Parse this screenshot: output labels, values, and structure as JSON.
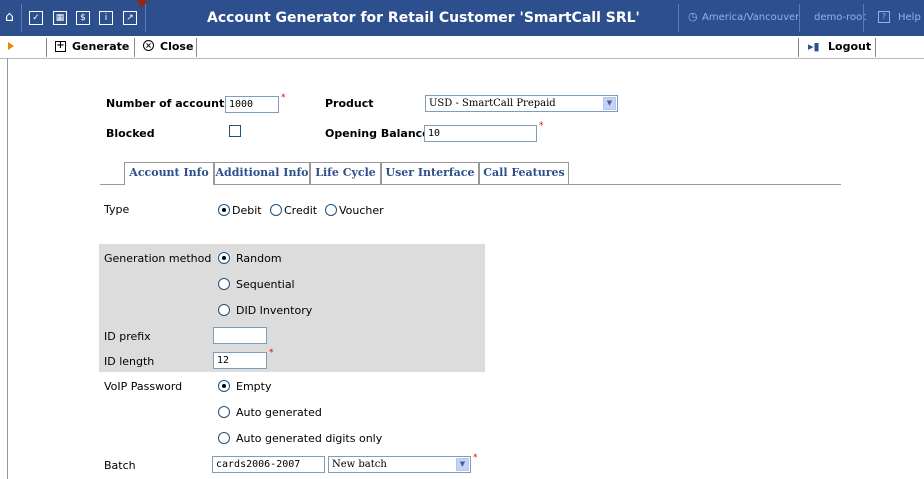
{
  "topbar": {
    "title": "Account Generator for Retail Customer 'SmartCall SRL'",
    "timezone": "America/Vancouver",
    "user": "demo-root",
    "help": "Help",
    "bg_color": "#2d4f8e"
  },
  "toolbar": {
    "generate_label": "Generate",
    "close_label": "Close",
    "logout_label": "Logout"
  },
  "form": {
    "number_of_accounts_label": "Number of accounts",
    "number_of_accounts_value": "1000",
    "product_label": "Product",
    "product_value": "USD - SmartCall Prepaid",
    "blocked_label": "Blocked",
    "opening_balance_label": "Opening Balance",
    "opening_balance_value": "10"
  },
  "tabs": [
    {
      "label": "Account Info"
    },
    {
      "label": "Additional Info"
    },
    {
      "label": "Life Cycle"
    },
    {
      "label": "User Interface"
    },
    {
      "label": "Call Features"
    }
  ],
  "account_info": {
    "type_label": "Type",
    "type_options": [
      "Debit",
      "Credit",
      "Voucher"
    ],
    "type_selected": "Debit",
    "generation_method_label": "Generation method",
    "generation_options": [
      "Random",
      "Sequential",
      "DID Inventory"
    ],
    "generation_selected": "Random",
    "id_prefix_label": "ID prefix",
    "id_prefix_value": "",
    "id_length_label": "ID length",
    "id_length_value": "12",
    "voip_password_label": "VoIP Password",
    "voip_options": [
      "Empty",
      "Auto generated",
      "Auto generated digits only"
    ],
    "voip_selected": "Empty",
    "batch_label": "Batch",
    "batch_value": "cards2006-2007",
    "batch_select_value": "New batch"
  }
}
